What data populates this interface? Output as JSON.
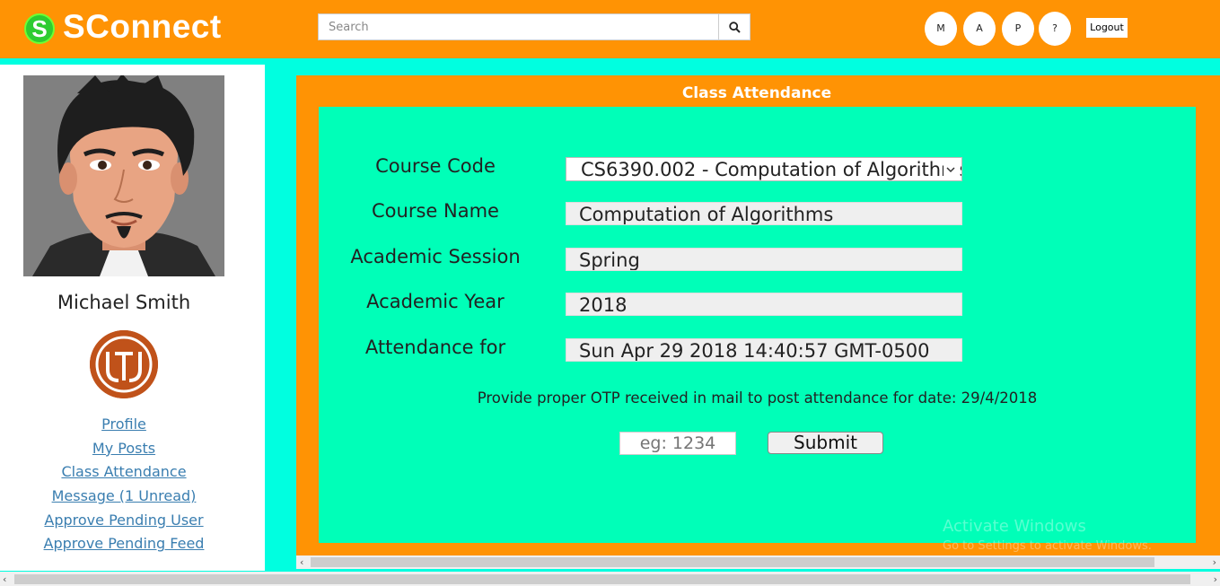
{
  "header": {
    "logo_letter": "S",
    "brand": "SConnect",
    "search_placeholder": "Search",
    "circles": [
      "M",
      "A",
      "P",
      "?"
    ],
    "logout_label": "Logout"
  },
  "sidebar": {
    "user_name": "Michael Smith",
    "school_logo_text": "UTD",
    "links": [
      "Profile",
      "My Posts",
      "Class Attendance",
      "Message (1 Unread)",
      "Approve Pending User",
      "Approve Pending Feed"
    ]
  },
  "main": {
    "title": "Class Attendance",
    "fields": [
      {
        "label": "Course Code",
        "value": "CS6390.002 - Computation of Algorithms"
      },
      {
        "label": "Course Name",
        "value": "Computation of Algorithms"
      },
      {
        "label": "Academic Session",
        "value": "Spring"
      },
      {
        "label": "Academic Year",
        "value": "2018"
      },
      {
        "label": "Attendance for",
        "value": "Sun Apr 29 2018 14:40:57 GMT-0500"
      }
    ],
    "otp_message": "Provide proper OTP received in mail to post attendance for date: 29/4/2018",
    "otp_placeholder": "eg: 1234",
    "submit_label": "Submit"
  },
  "watermark": {
    "line1": "Activate Windows",
    "line2": "Go to Settings to activate Windows."
  },
  "colors": {
    "header_orange": "#ff9304",
    "background_cyan": "#00ffe0",
    "panel_green": "#00ffb8",
    "link_blue": "#3a7eb0"
  }
}
